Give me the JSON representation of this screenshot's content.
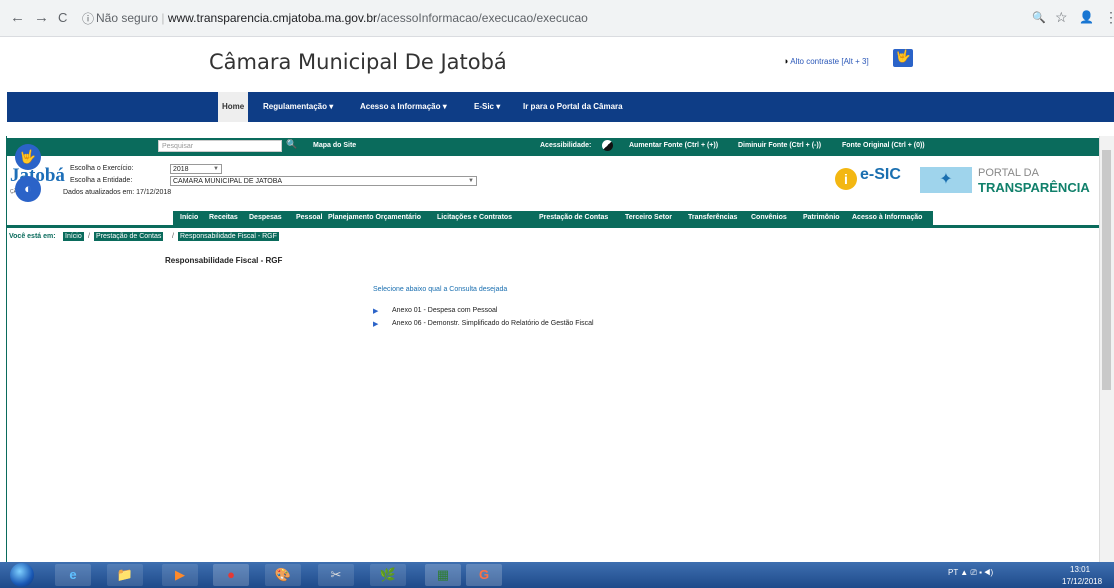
{
  "browser": {
    "back": "←",
    "forward": "→",
    "reload": "C",
    "info": "ⓘ",
    "security": "Não seguro",
    "url_host": "www.transparencia.cmjatoba.ma.gov.br",
    "url_path": "/acessoInformacao/execucao/execucao",
    "zoom_icon": "🔍",
    "star_icon": "☆",
    "profile_icon": "👤",
    "menu_icon": "⋮"
  },
  "header": {
    "title": "Câmara Municipal De Jatobá",
    "contrast": "Alto contraste [Alt + 3]",
    "libras": "🤟"
  },
  "topmenu": {
    "home": "Home",
    "items": [
      "Regulamentação ▾",
      "Acesso a Informação ▾",
      "E-Sic ▾",
      "Ir para o Portal da Câmara"
    ]
  },
  "toolbar": {
    "search_placeholder": "Pesquisar",
    "search_icon": "🔍",
    "mapa": "Mapa do Site",
    "acess": "Acessibilidade:",
    "aumentar": "Aumentar Fonte (Ctrl + (+))",
    "diminuir": "Diminuir Fonte (Ctrl + (-))",
    "original": "Fonte Original (Ctrl + (0))"
  },
  "logo": {
    "text": "Jatobá",
    "sub": "ÇÃO MUNICI"
  },
  "filters": {
    "exercicio_label": "Escolha o Exercício:",
    "exercicio_value": "2018",
    "entidade_label": "Escolha a Entidade:",
    "entidade_value": "CAMARA MUNICIPAL DE JATOBA",
    "updated": "Dados atualizados em: 17/12/2018"
  },
  "esic": {
    "i": "i",
    "text": "e-SIC"
  },
  "portal": {
    "line1": "PORTAL DA",
    "line2": "TRANSPARÊNCIA"
  },
  "greennav": [
    "Início",
    "Receitas",
    "Despesas",
    "Pessoal",
    "Planejamento Orçamentário",
    "Licitações e Contratos",
    "Prestação de Contas",
    "Terceiro Setor",
    "Transferências",
    "Convênios",
    "Patrimônio",
    "Acesso à Informação"
  ],
  "breadcrumb": {
    "label": "Você está em:",
    "items": [
      "Início",
      "Prestação de Contas",
      "Responsabilidade Fiscal - RGF"
    ]
  },
  "content": {
    "title": "Responsabilidade Fiscal - RGF",
    "hint": "Selecione abaixo qual a Consulta desejada",
    "annexes": [
      "Anexo 01 - Despesa com Pessoal",
      "Anexo 06 - Demonstr. Simplificado do Relatório de Gestão Fiscal"
    ]
  },
  "taskbar": {
    "apps": [
      "e",
      "📁",
      "▶",
      "●",
      "🎨",
      "✂",
      "🌿",
      "▦",
      "G"
    ],
    "tray": "PT  ▲  ⎚  ▪  ◀)",
    "time": "13:01",
    "date": "17/12/2018"
  }
}
